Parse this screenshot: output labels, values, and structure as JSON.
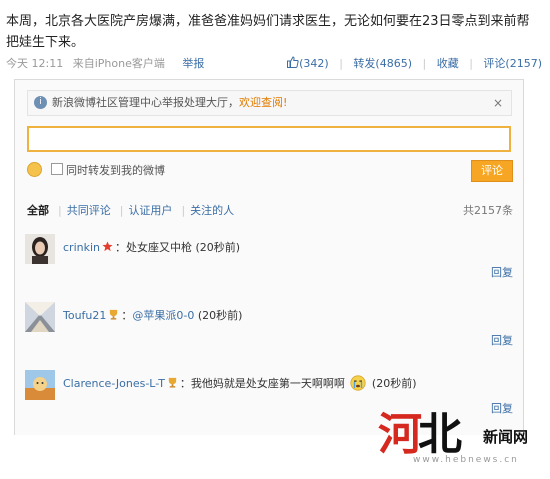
{
  "post": {
    "text": "本周，北京各大医院产房爆满，准爸爸准妈妈们请求医生，无论如何要在23日零点到来前帮把娃生下来。",
    "time": "今天 12:11",
    "source": "来自iPhone客户端",
    "report": "举报",
    "likes": "(342)",
    "repost": "转发(4865)",
    "favorite": "收藏",
    "comments": "评论(2157)"
  },
  "notice": {
    "text": "新浪微博社区管理中心举报处理大厅，",
    "link": "欢迎查阅!",
    "close": "×"
  },
  "composer": {
    "input_value": "",
    "repost_label": "同时转发到我的微博",
    "submit": "评论"
  },
  "tabs": {
    "all": "全部",
    "same": "共同评论",
    "verified": "认证用户",
    "following": "关注的人",
    "total": "共2157条"
  },
  "comments": [
    {
      "user": "crinkin",
      "mention": "",
      "text": "：处女座又中枪",
      "time": "(20秒前)",
      "reply": "回复"
    },
    {
      "user": "Toufu21",
      "mention": "@苹果派0-0",
      "text": "",
      "time": "(20秒前)",
      "reply": "回复"
    },
    {
      "user": "Clarence-Jones-L-T",
      "mention": "",
      "text": "：我他妈就是处女座第一天啊啊啊",
      "time": "(20秒前)",
      "reply": "回复"
    }
  ],
  "watermark": {
    "logo_part1": "河",
    "logo_part2": "北",
    "news": "新闻网",
    "url": "www.hebnews.cn"
  },
  "colors": {
    "link": "#3b6ea5",
    "accent": "#f6a623",
    "highlight_link": "#e07b00",
    "watermark_red": "#d5281f"
  }
}
